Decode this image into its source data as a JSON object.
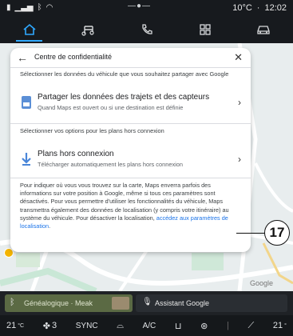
{
  "status": {
    "temperature": "10°C",
    "separator": "·",
    "time": "12:02"
  },
  "nav": {
    "tabs": [
      {
        "name": "home",
        "icon": "home-icon",
        "active": true
      },
      {
        "name": "music",
        "icon": "music-icon",
        "active": false
      },
      {
        "name": "phone",
        "icon": "phone-icon",
        "active": false
      },
      {
        "name": "apps",
        "icon": "apps-grid-icon",
        "active": false
      },
      {
        "name": "vehicle",
        "icon": "car-icon",
        "active": false
      }
    ],
    "accent_color": "#2fa8ff"
  },
  "dialog": {
    "title": "Centre de confidentialité",
    "section1": "Sélectionner les données du véhicule que vous souhaitez partager avec Google",
    "share_row": {
      "title": "Partager les données des trajets et des capteurs",
      "subtitle": "Quand Maps est ouvert ou si une destination est définie"
    },
    "section2": "Sélectionner vos options pour les plans hors connexion",
    "offline_row": {
      "title": "Plans hors connexion",
      "subtitle": "Télécharger automatiquement les plans hors connexion"
    },
    "paragraph": "Pour indiquer où vous vous trouvez sur la carte, Maps enverra parfois des informations sur votre position à Google, même si tous ces paramètres sont désactivés. Pour vous permettre d'utiliser les fonctionnalités du véhicule, Maps transmettra également des données de localisation (y compris votre itinéraire) au système du véhicule. Pour désactiver la localisation,",
    "link": "accédez aux paramètres de localisation",
    "period": "."
  },
  "callout": "17",
  "map": {
    "google_label": "Google"
  },
  "media": {
    "source_label": "Généalogique · Meak",
    "assistant_label": "Assistant Google"
  },
  "climate": {
    "left_temp": "21",
    "left_unit": "°C",
    "fan_level": "3",
    "sync_label": "SYNC",
    "ac_label": "A/C",
    "right_temp": "21",
    "right_unit": "°"
  }
}
